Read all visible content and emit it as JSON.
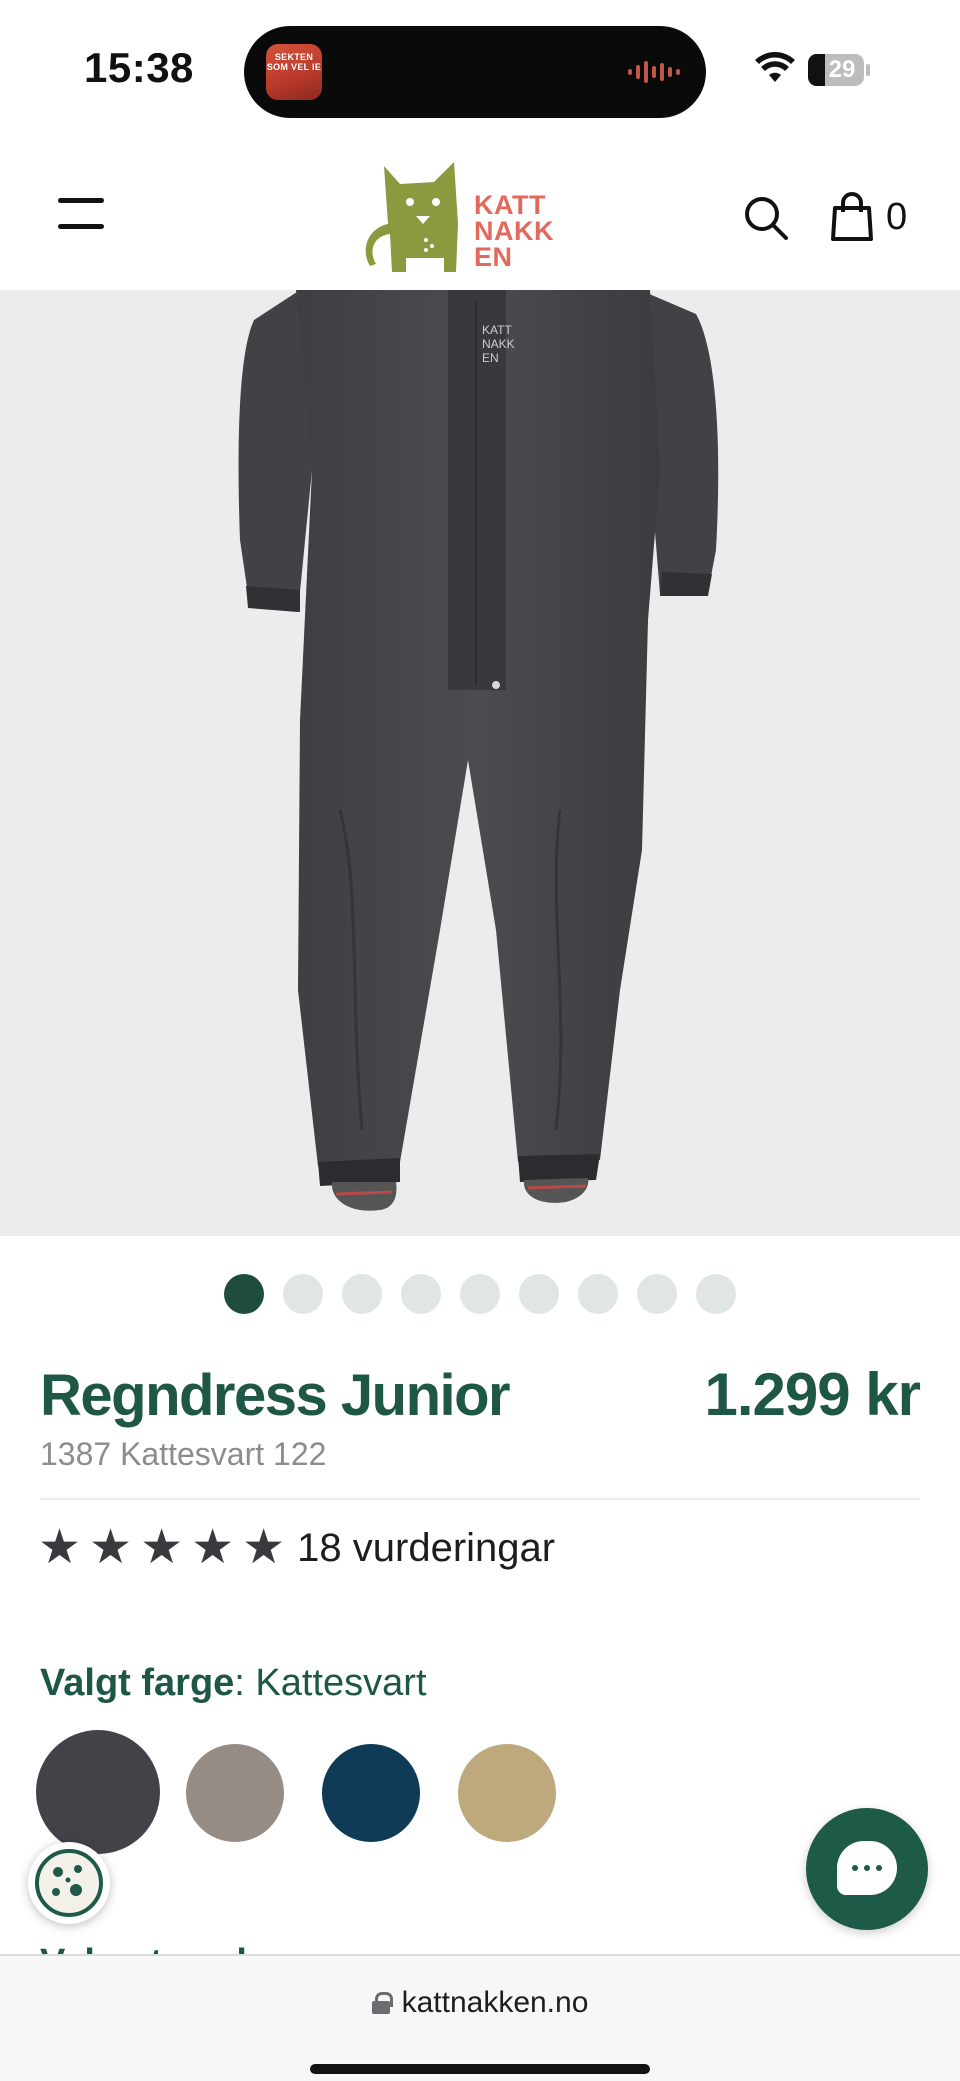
{
  "status_bar": {
    "time": "15:38",
    "battery": "29",
    "island_art_text": "SEKTEN SOM VEL IE"
  },
  "header": {
    "logo_text": "KATT NAKK EN",
    "cart_count": "0",
    "brand_color": "#e26a5c",
    "logo_color": "#8c9a3f"
  },
  "product": {
    "title": "Regndress Junior",
    "price": "1.299 kr",
    "variant": "1387 Kattesvart 122",
    "rating_stars": 5,
    "rating_text": "18 vurderingar",
    "accent_color": "#1e5745"
  },
  "carousel": {
    "total": 9,
    "active_index": 0
  },
  "color_picker": {
    "label": "Valgt farge",
    "selected": "Kattesvart",
    "swatches": [
      "#424249",
      "#958c86",
      "#0f3b57",
      "#bda97c"
    ]
  },
  "next_section_label": "Velg størrelse",
  "browser": {
    "url": "kattnakken.no"
  }
}
